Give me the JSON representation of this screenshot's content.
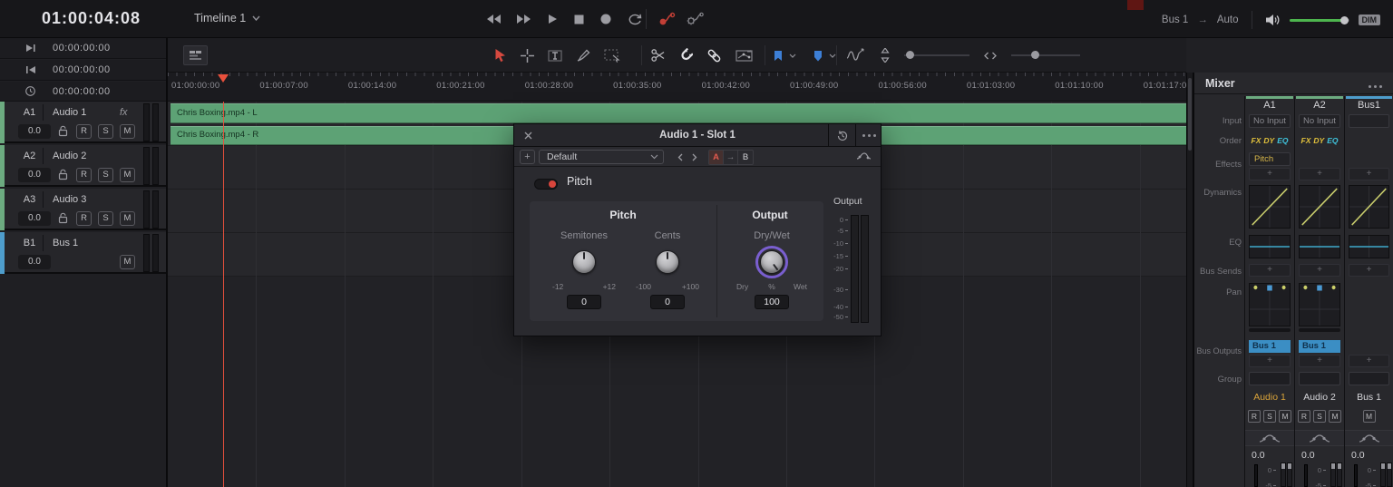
{
  "colors": {
    "clip_green": "#5da275",
    "track_green": "#6cab80",
    "bus_blue": "#4e9dcc",
    "playhead_red": "#e8503c",
    "selection_red": "#d6493f",
    "tool_blue": "#3d7fd6",
    "volume_green": "#4db54e",
    "drywet_ring": "#7a5fd0",
    "toggle_red": "#d8453c"
  },
  "top_bar": {
    "timecode": "01:00:04:08",
    "timeline_name": "Timeline 1",
    "monitor_bus": "Bus 1",
    "monitor_arrow": "→",
    "monitor_mode": "Auto",
    "dim": "DIM",
    "transport_icons": [
      "rewind",
      "fast-forward",
      "play",
      "stop",
      "record",
      "loop"
    ]
  },
  "left_panel": {
    "timecode_rows": [
      {
        "icon": "skip-to-end-icon",
        "value": "00:00:00:00"
      },
      {
        "icon": "skip-to-start-icon",
        "value": "00:00:00:00"
      },
      {
        "icon": "clock-icon",
        "value": "00:00:00:00"
      }
    ],
    "tracks": [
      {
        "id": "A1",
        "name": "Audio 1",
        "fx_label": "fx",
        "volume": "0.0",
        "buttons": [
          "R",
          "S",
          "M"
        ],
        "color": "#6cab80",
        "has_lock": true
      },
      {
        "id": "A2",
        "name": "Audio 2",
        "volume": "0.0",
        "buttons": [
          "R",
          "S",
          "M"
        ],
        "color": "#6cab80",
        "has_lock": true
      },
      {
        "id": "A3",
        "name": "Audio 3",
        "volume": "0.0",
        "buttons": [
          "R",
          "S",
          "M"
        ],
        "color": "#6cab80",
        "has_lock": true
      },
      {
        "id": "B1",
        "name": "Bus 1",
        "volume": "0.0",
        "buttons": [
          "M"
        ],
        "color": "#4e9dcc",
        "has_lock": false
      }
    ]
  },
  "toolbar": {
    "icons": [
      "timeline-view-options",
      "pointer",
      "range-select",
      "trim-edit",
      "pen",
      "keyframe-select",
      "razor",
      "snap",
      "link",
      "flag",
      "marker",
      "waveform-zoom",
      "vertical-zoom",
      "horizontal-zoom"
    ]
  },
  "timeline": {
    "ruler_labels": [
      "01:00:00:00",
      "01:00:07:00",
      "01:00:14:00",
      "01:00:21:00",
      "01:00:28:00",
      "01:00:35:00",
      "01:00:42:00",
      "01:00:49:00",
      "01:00:56:00",
      "01:01:03:00",
      "01:01:10:00",
      "01:01:17:00"
    ],
    "clips": [
      {
        "label": "Chris Boxing.mp4 - L"
      },
      {
        "label": "Chris Boxing.mp4 - R"
      }
    ]
  },
  "plugin": {
    "title": "Audio 1 - Slot 1",
    "add_label": "+",
    "preset": "Default",
    "ab": {
      "a": "A",
      "arrow": "→",
      "b": "B"
    },
    "effect_toggle_label": "Pitch",
    "left_section_title": "Pitch",
    "right_section_title": "Output",
    "knobs": {
      "semitones": {
        "label": "Semitones",
        "min": "-12",
        "max": "+12",
        "value": "0"
      },
      "cents": {
        "label": "Cents",
        "min": "-100",
        "max": "+100",
        "value": "0"
      },
      "drywet": {
        "label": "Dry/Wet",
        "min": "Dry",
        "mid": "%",
        "max": "Wet",
        "value": "100"
      }
    },
    "meter": {
      "label": "Output",
      "ticks": [
        "0",
        "-5",
        "-10",
        "-15",
        "-20",
        "-30",
        "-40",
        "-50"
      ]
    }
  },
  "mixer": {
    "title": "Mixer",
    "add_label": "+",
    "row_labels": {
      "input": "Input",
      "order": "Order",
      "effects": "Effects",
      "dynamics": "Dynamics",
      "eq": "EQ",
      "bus_sends": "Bus Sends",
      "pan": "Pan",
      "bus_outputs": "Bus Outputs",
      "group": "Group"
    },
    "fader_ticks": [
      "0",
      "-5"
    ],
    "strips": [
      {
        "id": "A1",
        "color": "#6cab80",
        "input": "No Input",
        "order": [
          {
            "t": "FX",
            "c": "#e2c23c"
          },
          {
            "t": "DY",
            "c": "#e2c23c"
          },
          {
            "t": "EQ",
            "c": "#3fc3dc"
          }
        ],
        "effect": "Pitch",
        "bus_output": "Bus 1",
        "name": "Audio 1",
        "name_selected": true,
        "buttons": [
          "R",
          "S",
          "M"
        ],
        "volume": "0.0",
        "pan": true
      },
      {
        "id": "A2",
        "color": "#6cab80",
        "input": "No Input",
        "order": [
          {
            "t": "FX",
            "c": "#e2c23c"
          },
          {
            "t": "DY",
            "c": "#e2c23c"
          },
          {
            "t": "EQ",
            "c": "#3fc3dc"
          }
        ],
        "effect": null,
        "bus_output": "Bus 1",
        "name": "Audio 2",
        "name_selected": false,
        "buttons": [
          "R",
          "S",
          "M"
        ],
        "volume": "0.0",
        "pan": true
      },
      {
        "id": "Bus1",
        "color": "#4e9dcc",
        "input": "",
        "order": [],
        "effect": null,
        "bus_output": null,
        "name": "Bus 1",
        "name_selected": false,
        "buttons": [
          "M"
        ],
        "volume": "0.0",
        "pan": false
      }
    ]
  }
}
